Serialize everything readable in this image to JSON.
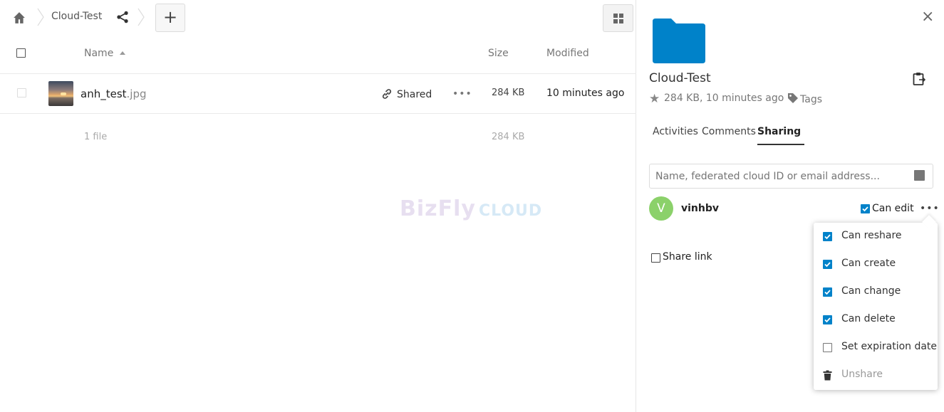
{
  "breadcrumb": {
    "folder_name": "Cloud-Test",
    "add_label": "+"
  },
  "file_list": {
    "headers": {
      "name": "Name",
      "size": "Size",
      "modified": "Modified"
    },
    "rows": [
      {
        "name": "anh_test",
        "ext": ".jpg",
        "shared_label": "Shared",
        "more_label": "•••",
        "size": "284 KB",
        "modified": "10 minutes ago"
      }
    ],
    "summary": {
      "count": "1 file",
      "size": "284 KB"
    }
  },
  "watermark": {
    "text_a": "BizFly",
    "text_b": "CLOUD"
  },
  "sidebar": {
    "close_label": "×",
    "title": "Cloud-Test",
    "meta": "284 KB, 10 minutes ago",
    "tags_label": "Tags",
    "tabs": [
      {
        "label": "Activities"
      },
      {
        "label": "Comments"
      },
      {
        "label": "Sharing"
      }
    ],
    "share_input_placeholder": "Name, federated cloud ID or email address...",
    "share_user": {
      "initial": "V",
      "name": "vinhbv",
      "can_edit_label": "Can edit",
      "can_edit_checked": true,
      "more_label": "•••"
    },
    "share_link_label": "Share link",
    "menu": [
      {
        "label": "Can reshare",
        "checked": true
      },
      {
        "label": "Can create",
        "checked": true
      },
      {
        "label": "Can change",
        "checked": true
      },
      {
        "label": "Can delete",
        "checked": true
      },
      {
        "label": "Set expiration date",
        "checked": false
      },
      {
        "label": "Unshare",
        "icon": "trash-icon"
      }
    ]
  },
  "colors": {
    "accent": "#0082c9",
    "avatar": "#8bd16a",
    "folder": "#0082c9"
  }
}
